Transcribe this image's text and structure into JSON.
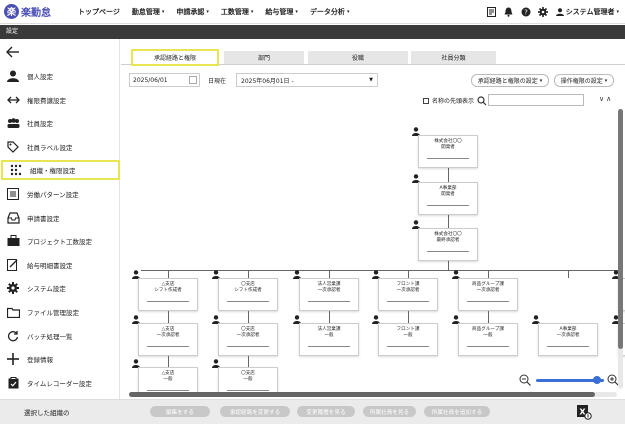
{
  "header": {
    "logo_mark": "楽",
    "logo_text": "楽勤怠",
    "nav": [
      {
        "label": "トップページ",
        "has_caret": false
      },
      {
        "label": "勤怠管理",
        "has_caret": true
      },
      {
        "label": "申請承認",
        "has_caret": true
      },
      {
        "label": "工数管理",
        "has_caret": true
      },
      {
        "label": "給与管理",
        "has_caret": true
      },
      {
        "label": "データ分析",
        "has_caret": true
      }
    ],
    "icons": [
      "document-icon",
      "bell-icon",
      "help-icon",
      "gear-icon"
    ],
    "user_label": "システム管理者",
    "caret": "▾"
  },
  "page_title": "設定",
  "sidebar": {
    "items": [
      {
        "label": "個人設定",
        "icon": "person-icon"
      },
      {
        "label": "権限費譲設定",
        "icon": "arrows-icon"
      },
      {
        "label": "社員設定",
        "icon": "group-icon"
      },
      {
        "label": "社員ラベル設定",
        "icon": "tag-icon"
      },
      {
        "label": "組織・権限設定",
        "icon": "grid-dots-icon",
        "active": true
      },
      {
        "label": "労働パターン設定",
        "icon": "list-icon"
      },
      {
        "label": "申請書設定",
        "icon": "inbox-icon"
      },
      {
        "label": "プロジェクト工数設定",
        "icon": "briefcase-icon"
      },
      {
        "label": "給与明細書設定",
        "icon": "edit-doc-icon"
      },
      {
        "label": "システム設定",
        "icon": "gear-icon"
      },
      {
        "label": "ファイル管理設定",
        "icon": "folder-icon"
      },
      {
        "label": "バッチ処理一覧",
        "icon": "sync-icon"
      },
      {
        "label": "登録情報",
        "icon": "plus-icon"
      },
      {
        "label": "タイムレコーダー設定",
        "icon": "clipboard-icon"
      }
    ]
  },
  "tabs": [
    {
      "label": "承認経路と権限",
      "active": true
    },
    {
      "label": "部門"
    },
    {
      "label": "役職"
    },
    {
      "label": "社員分類"
    }
  ],
  "filters": {
    "date_value": "2025/06/01",
    "current_label": "日現在",
    "period_value": "2025年06月01日 -",
    "route_settings_button": "承認経路と権限の設定",
    "operation_settings_button": "操作権限の設定",
    "name_first_label": "名称の先頭表示",
    "search_value": ""
  },
  "org_chart": {
    "top_nodes": [
      {
        "line1": "株式会社〇〇",
        "line2": "開発者"
      },
      {
        "line1": "A事業部",
        "line2": "開発者"
      },
      {
        "line1": "株式会社〇〇",
        "line2": "最終承認者"
      }
    ],
    "columns": [
      [
        {
          "line1": "△支店",
          "line2": "シフト作成者"
        },
        {
          "line1": "△支店",
          "line2": "一次承認者"
        },
        {
          "line1": "△支店",
          "line2": "一般"
        }
      ],
      [
        {
          "line1": "〇支店",
          "line2": "シフト作成者"
        },
        {
          "line1": "〇支店",
          "line2": "一次承認者"
        },
        {
          "line1": "〇支店",
          "line2": "一般"
        }
      ],
      [
        {
          "line1": "法人営業課",
          "line2": "一次承認者"
        },
        {
          "line1": "法人営業課",
          "line2": "一般"
        }
      ],
      [
        {
          "line1": "フロント課",
          "line2": "一次承認者"
        },
        {
          "line1": "フロント課",
          "line2": "一般"
        }
      ],
      [
        {
          "line1": "商品グループ課",
          "line2": "一次承認者"
        },
        {
          "line1": "商品グループ課",
          "line2": "一般"
        }
      ],
      [
        {
          "line1": "",
          "line2": ""
        },
        {
          "line1": "A事業部",
          "line2": "一次承認者"
        }
      ],
      [
        {
          "line1": "営業課",
          "line2": "一次承認者"
        },
        {
          "line1": "A事業部",
          "line2": "一般"
        }
      ]
    ]
  },
  "zoom": {
    "level": 0.9
  },
  "bottom": {
    "selected_label": "選択した組織の",
    "buttons": [
      "編集をする",
      "承認経路を変更する",
      "変更履歴を見る",
      "所属社員を見る",
      "所属社員を追加する"
    ]
  },
  "colors": {
    "accent": "#4a4fb3",
    "highlight": "#e7e552",
    "zoom_blue": "#3a6fd8"
  }
}
